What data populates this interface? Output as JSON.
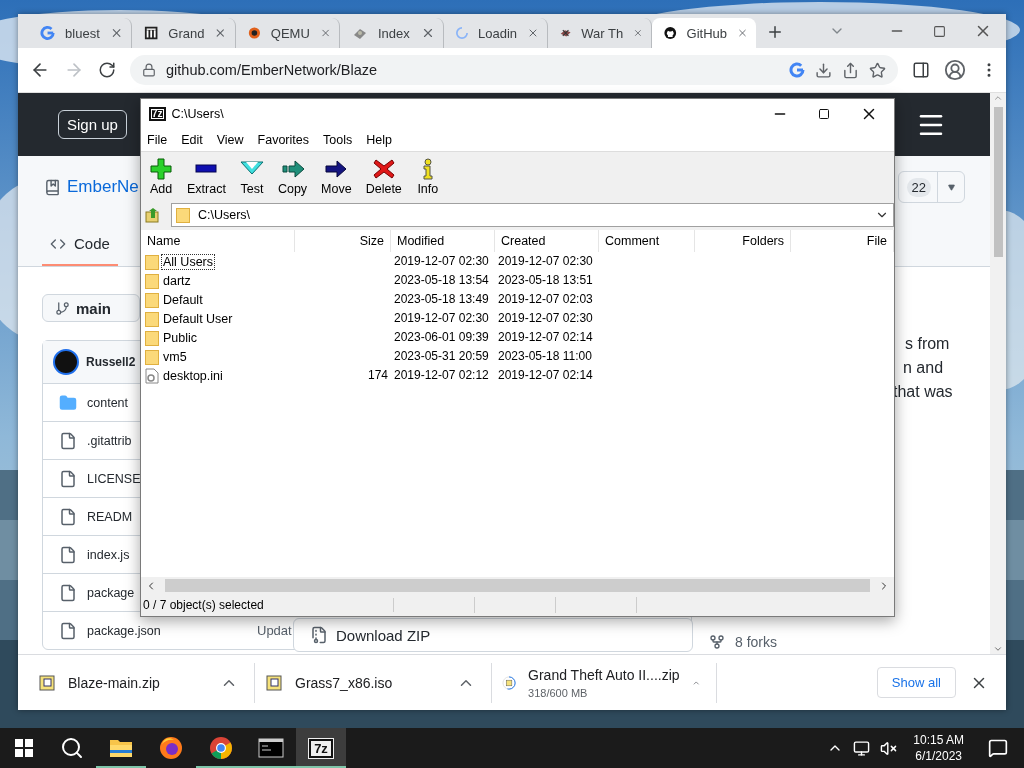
{
  "browser": {
    "tabs": [
      {
        "title": "bluest",
        "kind": "google",
        "selected": false
      },
      {
        "title": "Grand",
        "kind": "museum",
        "selected": false
      },
      {
        "title": "QEMU",
        "kind": "qemu",
        "selected": false
      },
      {
        "title": "Index",
        "kind": "generic",
        "selected": false
      },
      {
        "title": "Loadin",
        "kind": "loading",
        "selected": false
      },
      {
        "title": "War Th",
        "kind": "game",
        "selected": false
      },
      {
        "title": "GitHub",
        "kind": "github",
        "selected": true
      }
    ],
    "forward_disabled": true,
    "url": "github.com/EmberNetwork/Blaze",
    "downloads": [
      {
        "name": "Blaze-main.zip",
        "kind": "done"
      },
      {
        "name": "Grass7_x86.iso",
        "kind": "done"
      },
      {
        "name": "Grand Theft Auto II....zip",
        "detail": "318/600 MB",
        "kind": "progress"
      }
    ],
    "show_all": "Show all"
  },
  "github": {
    "sign_up": "Sign up",
    "repo": "EmberNe",
    "stars": "22",
    "tabs": [
      {
        "label": "Code",
        "selected": true
      }
    ],
    "branch": "main",
    "commit_author": "Russell2",
    "files": [
      {
        "name": "content",
        "kind": "folder"
      },
      {
        "name": ".gitattrib",
        "kind": "file"
      },
      {
        "name": "LICENSE",
        "kind": "file"
      },
      {
        "name": "READM",
        "kind": "file"
      },
      {
        "name": "index.js",
        "kind": "file"
      },
      {
        "name": "package",
        "kind": "file"
      },
      {
        "name": "package.json",
        "kind": "file",
        "updated": "Updat"
      }
    ],
    "about_lines": [
      "s from",
      "n and",
      "that was"
    ],
    "forks": "8 forks",
    "download_zip": "Download ZIP"
  },
  "sevenzip": {
    "title_icon": "7z",
    "title": "C:\\Users\\",
    "menu": [
      "File",
      "Edit",
      "View",
      "Favorites",
      "Tools",
      "Help"
    ],
    "toolbar": [
      {
        "label": "Add",
        "kind": "add"
      },
      {
        "label": "Extract",
        "kind": "extract"
      },
      {
        "label": "Test",
        "kind": "test"
      },
      {
        "label": "Copy",
        "kind": "copy"
      },
      {
        "label": "Move",
        "kind": "move"
      },
      {
        "label": "Delete",
        "kind": "delete"
      },
      {
        "label": "Info",
        "kind": "info"
      }
    ],
    "path": "C:\\Users\\",
    "columns": [
      "Name",
      "Size",
      "Modified",
      "Created",
      "Comment",
      "Folders",
      "File"
    ],
    "items": [
      {
        "name": "All Users",
        "kind": "folder",
        "modified": "2019-12-07 02:30",
        "created": "2019-12-07 02:30",
        "focused": true
      },
      {
        "name": "dartz",
        "kind": "folder",
        "modified": "2023-05-18 13:54",
        "created": "2023-05-18 13:51",
        "focused": false
      },
      {
        "name": "Default",
        "kind": "folder",
        "modified": "2023-05-18 13:49",
        "created": "2019-12-07 02:03",
        "focused": false
      },
      {
        "name": "Default User",
        "kind": "folder",
        "modified": "2019-12-07 02:30",
        "created": "2019-12-07 02:30",
        "focused": false
      },
      {
        "name": "Public",
        "kind": "folder",
        "modified": "2023-06-01 09:39",
        "created": "2019-12-07 02:14",
        "focused": false
      },
      {
        "name": "vm5",
        "kind": "folder",
        "modified": "2023-05-31 20:59",
        "created": "2023-05-18 11:00",
        "focused": false
      },
      {
        "name": "desktop.ini",
        "kind": "file",
        "size": "174",
        "modified": "2019-12-07 02:12",
        "created": "2019-12-07 02:14",
        "focused": false
      }
    ],
    "status": "0 / 7 object(s) selected"
  },
  "taskbar": {
    "apps": [
      {
        "kind": "start",
        "running": false,
        "selected": false
      },
      {
        "kind": "search",
        "running": false,
        "selected": false
      },
      {
        "kind": "explorer",
        "running": true,
        "selected": false
      },
      {
        "kind": "firefox",
        "running": false,
        "selected": false
      },
      {
        "kind": "chrome",
        "running": true,
        "selected": false
      },
      {
        "kind": "terminal",
        "running": true,
        "selected": false
      },
      {
        "kind": "sevenzip",
        "label": "7z",
        "running": true,
        "selected": true
      }
    ],
    "time": "10:15 AM",
    "date": "6/1/2023"
  }
}
